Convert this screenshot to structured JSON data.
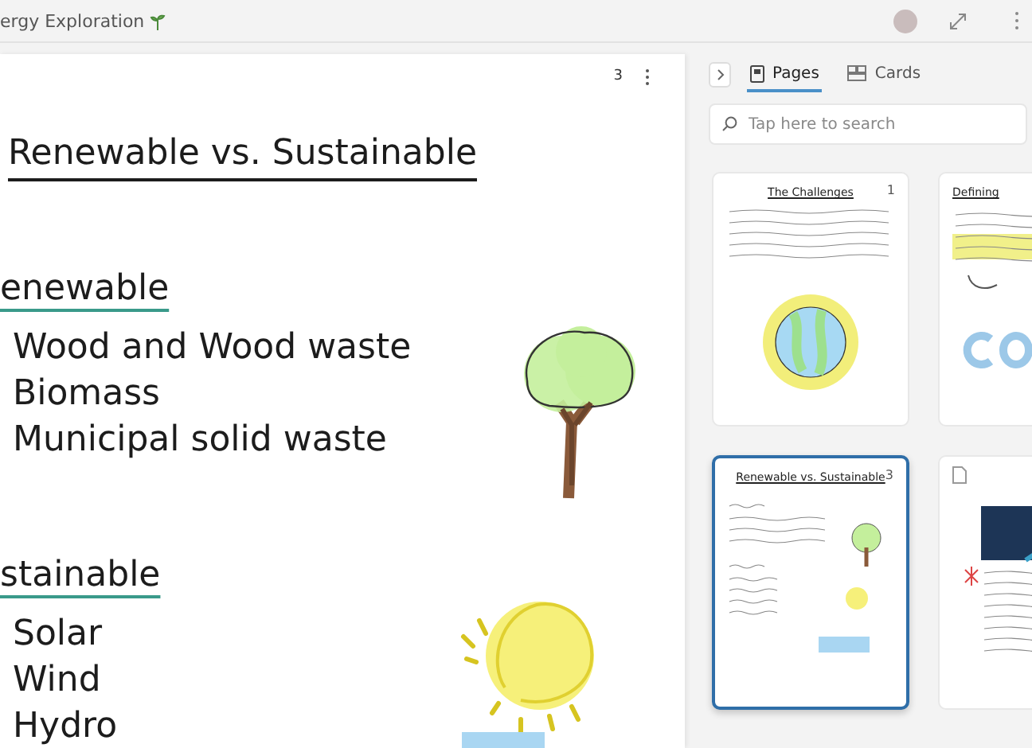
{
  "window": {
    "title": "ergy Exploration"
  },
  "canvas": {
    "page_number": "3",
    "ink": [
      {
        "kind": "title",
        "text": "Renewable vs. Sustainable"
      },
      {
        "kind": "heading",
        "text": "enewable"
      },
      {
        "kind": "item",
        "text": "Wood and Wood waste"
      },
      {
        "kind": "item",
        "text": "Biomass"
      },
      {
        "kind": "item",
        "text": "Municipal solid waste"
      },
      {
        "kind": "heading",
        "text": "stainable"
      },
      {
        "kind": "item",
        "text": "Solar"
      },
      {
        "kind": "item",
        "text": "Wind"
      },
      {
        "kind": "item",
        "text": "Hydro"
      }
    ]
  },
  "panel": {
    "tabs": [
      {
        "label": "Pages",
        "selected": true
      },
      {
        "label": "Cards",
        "selected": false
      }
    ],
    "search": {
      "placeholder": "Tap here to search"
    },
    "pages": [
      {
        "kind": "earth",
        "title": "The Challenges",
        "number": "1",
        "selected": false
      },
      {
        "kind": "text",
        "title": "Defining",
        "selected": false
      },
      {
        "kind": "notes",
        "title": "Renewable vs. Sustainable",
        "number": "3",
        "selected": true
      },
      {
        "kind": "pdf",
        "selected": false
      }
    ]
  }
}
